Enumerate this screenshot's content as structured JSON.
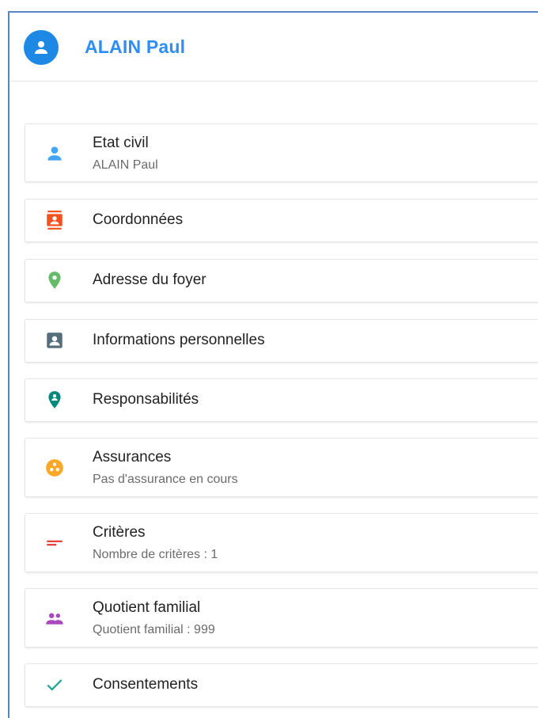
{
  "header": {
    "title": "ALAIN Paul",
    "avatar_icon": "person-icon"
  },
  "colors": {
    "accent": "#2f8ef4",
    "avatar_bg": "#1e88e5",
    "etat_civil_icon": "#42a5f5",
    "coordonnees_icon": "#f4511e",
    "adresse_icon": "#66bb6a",
    "infos_icon": "#546e7a",
    "responsabilites_icon": "#00897b",
    "assurances_icon": "#ffa726",
    "criteres_icon": "#e53935",
    "quotient_icon": "#ab47bc",
    "consentements_icon": "#26a69a"
  },
  "sections": {
    "etat_civil": {
      "title": "Etat civil",
      "subtitle": "ALAIN Paul",
      "icon": "person-icon"
    },
    "coordonnees": {
      "title": "Coordonnées",
      "icon": "contact-card-icon"
    },
    "adresse": {
      "title": "Adresse du foyer",
      "icon": "location-pin-icon"
    },
    "infos": {
      "title": "Informations personnelles",
      "icon": "account-box-icon"
    },
    "responsabilites": {
      "title": "Responsabilités",
      "icon": "person-pin-icon"
    },
    "assurances": {
      "title": "Assurances",
      "subtitle": "Pas d'assurance en cours",
      "icon": "circles-icon"
    },
    "criteres": {
      "title": "Critères",
      "subtitle": "Nombre de critères : 1",
      "icon": "short-text-icon"
    },
    "quotient": {
      "title": "Quotient familial",
      "subtitle": "Quotient familial : 999",
      "icon": "people-icon"
    },
    "consentements": {
      "title": "Consentements",
      "icon": "check-icon"
    }
  }
}
